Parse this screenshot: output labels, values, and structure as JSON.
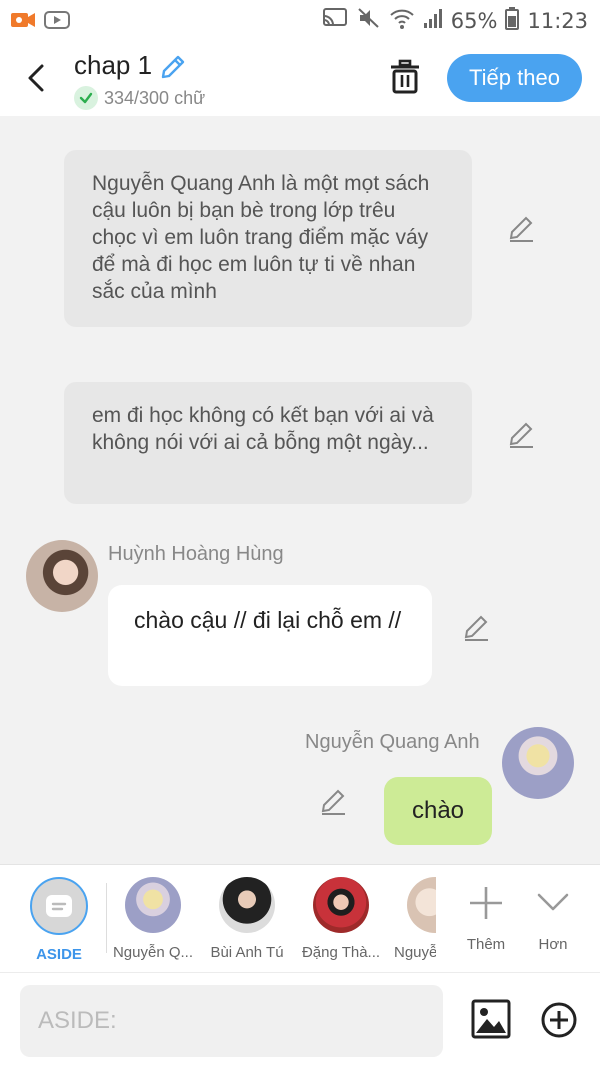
{
  "status_bar": {
    "battery": "65%",
    "time": "11:23",
    "icons": [
      "video-call-icon",
      "youtube-icon",
      "cast-icon",
      "mute-icon",
      "wifi-icon",
      "signal-icon",
      "battery-icon"
    ]
  },
  "header": {
    "title": "chap 1",
    "word_count": "334/300 chữ",
    "next_label": "Tiếp theo"
  },
  "messages": [
    {
      "type": "narration",
      "text": "Nguyễn Quang Anh là một mọt sách cậu luôn bị bạn bè trong lớp trêu chọc vì em luôn trang điểm mặc váy để mà đi học em luôn tự ti về nhan sắc của mình"
    },
    {
      "type": "narration",
      "text": "em đi học không có kết bạn với ai và không nói với ai cả bỗng một ngày..."
    },
    {
      "type": "left",
      "speaker": "Huỳnh Hoàng Hùng",
      "text": "chào cậu // đi lại chỗ em //"
    },
    {
      "type": "right",
      "speaker": "Nguyễn Quang Anh",
      "text": "chào"
    }
  ],
  "characters": {
    "aside_label": "ASIDE",
    "items": [
      {
        "label": "Nguyễn Q..."
      },
      {
        "label": "Bùi Anh Tú"
      },
      {
        "label": "Đặng Thà..."
      },
      {
        "label": "Nguyễ"
      }
    ],
    "more_label": "Thêm",
    "expand_label": "Hơn"
  },
  "input": {
    "placeholder": "ASIDE:"
  },
  "colors": {
    "accent": "#4aa3f0",
    "bubble_green": "#cdeb96",
    "narration_bg": "#e7e7e7"
  }
}
